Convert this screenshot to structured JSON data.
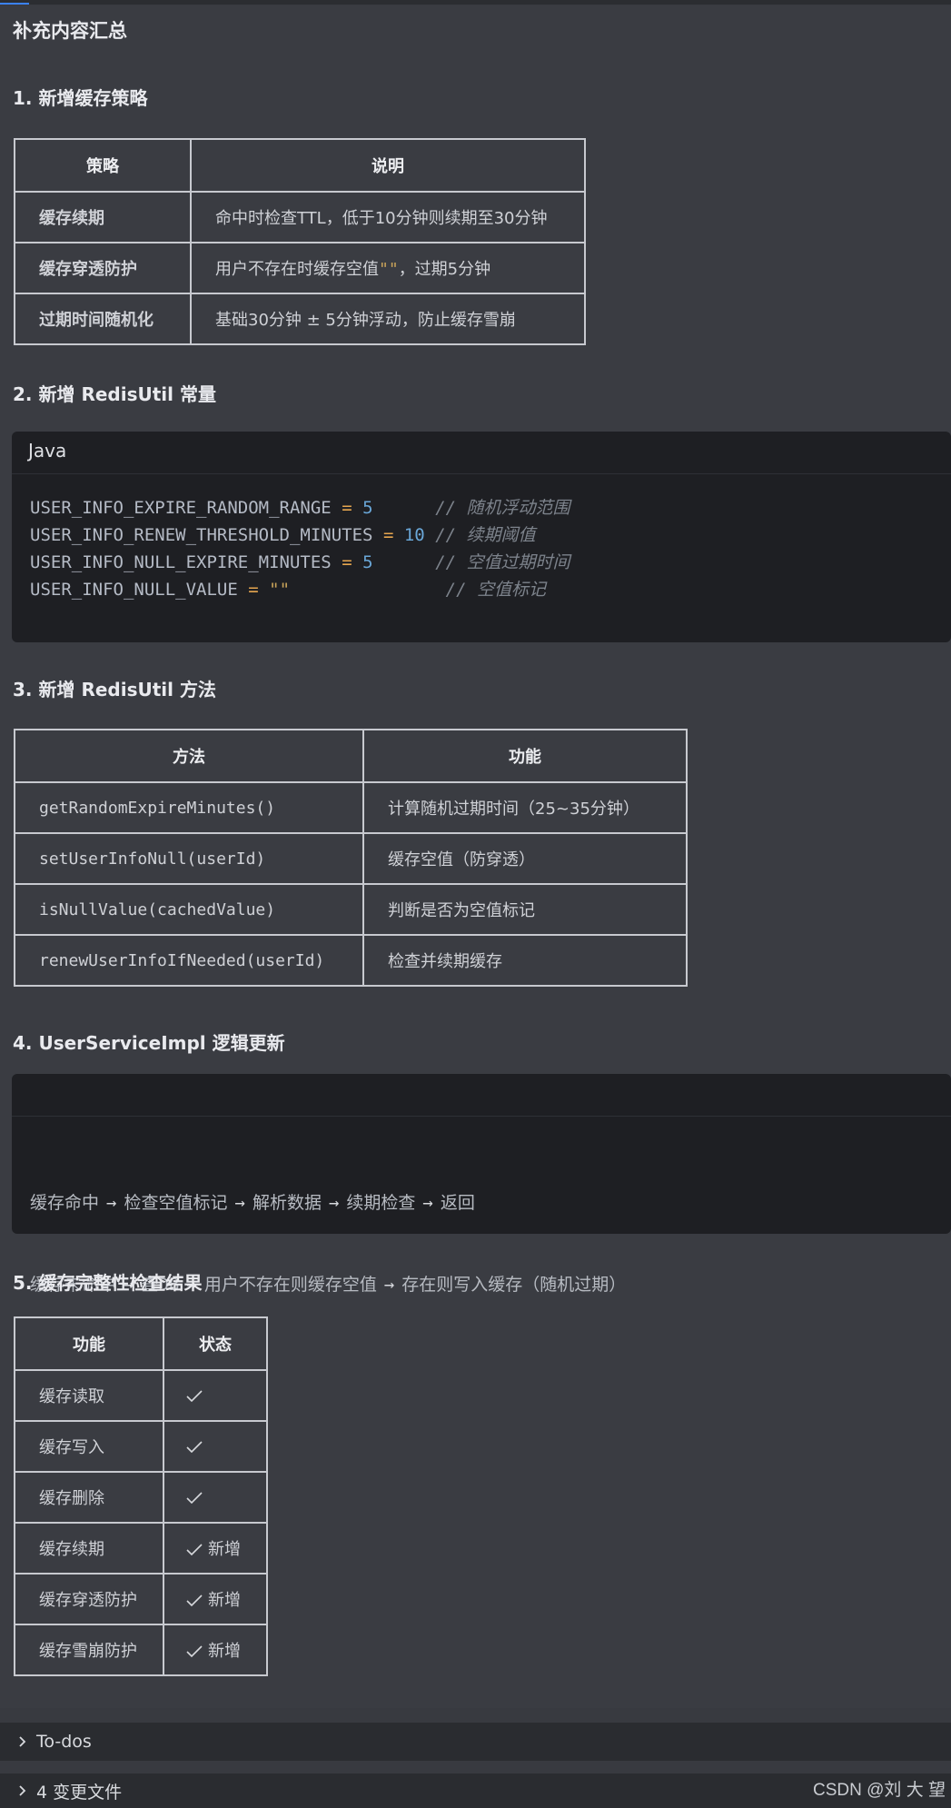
{
  "summary_title": "补充内容汇总",
  "section1": {
    "heading": "1. 新增缓存策略",
    "headers": [
      "策略",
      "说明"
    ],
    "rows": [
      {
        "name": "缓存续期",
        "desc": "命中时检查TTL，低于10分钟则续期至30分钟"
      },
      {
        "name": "缓存穿透防护",
        "desc_pre": "用户不存在时缓存空值",
        "desc_code": "\"\"",
        "desc_post": "，过期5分钟"
      },
      {
        "name": "过期时间随机化",
        "desc": "基础30分钟 ± 5分钟浮动，防止缓存雪崩"
      }
    ]
  },
  "section2": {
    "heading": "2. 新增 RedisUtil 常量",
    "lang": "Java",
    "lines": [
      {
        "name": "USER_INFO_EXPIRE_RANDOM_RANGE",
        "op": "=",
        "value": "5",
        "pad": "      ",
        "comment": "// 随机浮动范围"
      },
      {
        "name": "USER_INFO_RENEW_THRESHOLD_MINUTES",
        "op": "=",
        "value": "10",
        "pad": " ",
        "comment": "// 续期阈值"
      },
      {
        "name": "USER_INFO_NULL_EXPIRE_MINUTES",
        "op": "=",
        "value": "5",
        "pad": "      ",
        "comment": "// 空值过期时间"
      },
      {
        "name": "USER_INFO_NULL_VALUE",
        "op": "=",
        "value": "\"\"",
        "pad": "               ",
        "comment": "// 空值标记"
      }
    ]
  },
  "section3": {
    "heading": "3. 新增 RedisUtil 方法",
    "headers": [
      "方法",
      "功能"
    ],
    "rows": [
      {
        "method": "getRandomExpireMinutes()",
        "func": "计算随机过期时间（25~35分钟）"
      },
      {
        "method": "setUserInfoNull(userId)",
        "func": "缓存空值（防穿透）"
      },
      {
        "method": "isNullValue(cachedValue)",
        "func": "判断是否为空值标记"
      },
      {
        "method": "renewUserInfoIfNeeded(userId)",
        "func": "检查并续期缓存"
      }
    ]
  },
  "section4": {
    "heading": "4. UserServiceImpl 逻辑更新",
    "flow1": [
      "缓存命中",
      "检查空值标记",
      "解析数据",
      "续期检查",
      "返回"
    ],
    "flow2": [
      "缓存未命中",
      "查DB",
      "用户不存在则缓存空值",
      "存在则写入缓存（随机过期）"
    ],
    "arrow": "→"
  },
  "section5": {
    "heading": "5. 缓存完整性检查结果",
    "headers": [
      "功能",
      "状态"
    ],
    "rows": [
      {
        "feature": "缓存读取",
        "status": ""
      },
      {
        "feature": "缓存写入",
        "status": ""
      },
      {
        "feature": "缓存删除",
        "status": ""
      },
      {
        "feature": "缓存续期",
        "status": "新增"
      },
      {
        "feature": "缓存穿透防护",
        "status": "新增"
      },
      {
        "feature": "缓存雪崩防护",
        "status": "新增"
      }
    ]
  },
  "todos_label": "To-dos",
  "changed_files_label": "4 变更文件",
  "watermark": "CSDN @刘 大 望"
}
